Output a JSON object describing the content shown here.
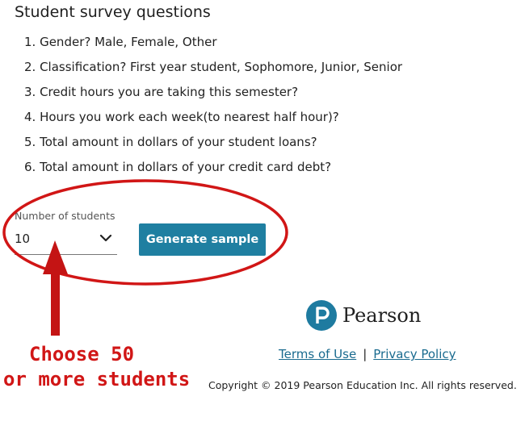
{
  "survey": {
    "title": "Student survey questions",
    "questions": [
      "1. Gender? Male, Female, Other",
      "2. Classification? First year student, Sophomore, Junior, Senior",
      "3. Credit hours you are taking this semester?",
      "4. Hours you work each week(to nearest half hour)?",
      "5. Total amount in dollars of your student loans?",
      "6. Total amount in dollars of your credit card debt?"
    ]
  },
  "sample_form": {
    "label": "Number of students",
    "selected_value": "10",
    "button_label": "Generate sample"
  },
  "annotation": {
    "line1": "Choose 50",
    "line2": "or more students",
    "color": "#d11616"
  },
  "footer": {
    "brand": "Pearson",
    "terms_label": "Terms of Use",
    "separator": "|",
    "privacy_label": "Privacy Policy",
    "copyright": "Copyright © 2019 Pearson Education Inc. All rights reserved."
  },
  "colors": {
    "button": "#1f7fa1",
    "link": "#1a6b8f",
    "brand_circle": "#1e7ba0"
  }
}
